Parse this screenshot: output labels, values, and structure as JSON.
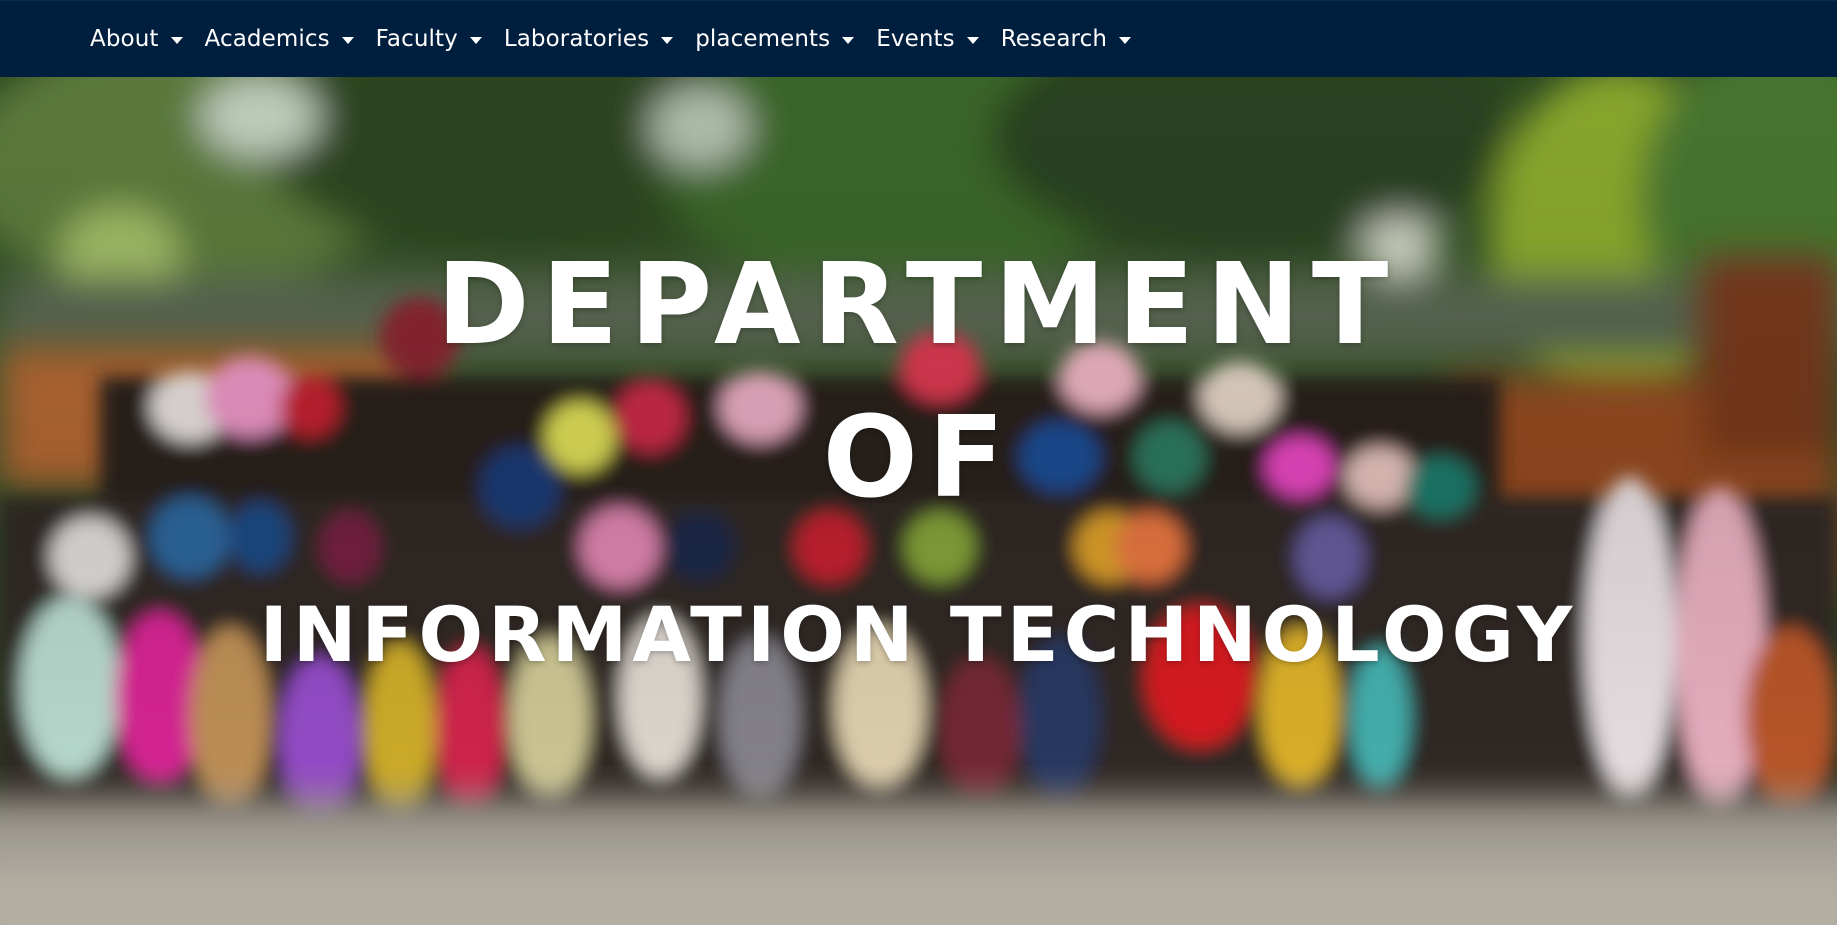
{
  "navbar": {
    "bg_color": "#001f3f",
    "items": [
      {
        "label": "About",
        "icon": "caret-down-icon"
      },
      {
        "label": "Academics",
        "icon": "caret-down-icon"
      },
      {
        "label": "Faculty",
        "icon": "caret-down-icon"
      },
      {
        "label": "Laboratories",
        "icon": "caret-down-icon"
      },
      {
        "label": "placements",
        "icon": "caret-down-icon"
      },
      {
        "label": "Events",
        "icon": "caret-down-icon"
      },
      {
        "label": "Research",
        "icon": "caret-down-icon"
      }
    ]
  },
  "hero": {
    "title_lines": [
      "DEPARTMENT",
      "OF",
      "INFORMATION TECHNOLOGY"
    ],
    "text_color": "#ffffff",
    "background": "blurred group photo"
  }
}
